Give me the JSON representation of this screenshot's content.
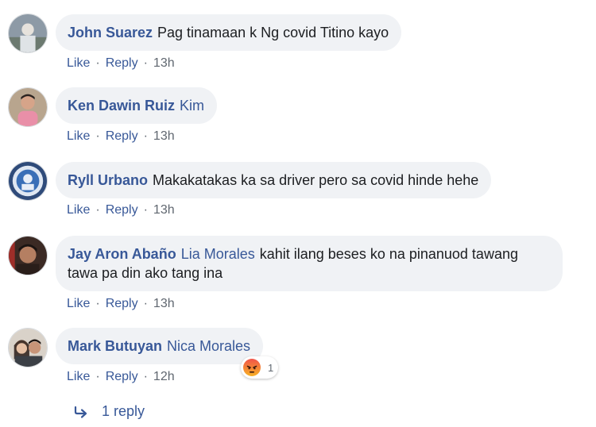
{
  "comments": [
    {
      "author": "John Suarez",
      "mention": "",
      "text": "Pag tinamaan k Ng covid Titino kayo",
      "like": "Like",
      "reply": "Reply",
      "time": "13h"
    },
    {
      "author": "Ken Dawin Ruiz",
      "mention": "",
      "text": "Kim",
      "like": "Like",
      "reply": "Reply",
      "time": "13h"
    },
    {
      "author": "Ryll Urbano",
      "mention": "",
      "text": "Makakatakas ka sa driver pero sa covid hinde hehe",
      "like": "Like",
      "reply": "Reply",
      "time": "13h"
    },
    {
      "author": "Jay Aron Abaño",
      "mention": "Lia Morales",
      "text": "kahit ilang beses ko na pinanuod tawang tawa pa din ako tang ina",
      "like": "Like",
      "reply": "Reply",
      "time": "13h"
    },
    {
      "author": "Mark Butuyan",
      "mention": "Nica Morales",
      "text": "",
      "like": "Like",
      "reply": "Reply",
      "time": "12h",
      "reaction_count": "1"
    }
  ],
  "replies_label": "1 reply",
  "colors": {
    "link": "#385898",
    "bubble": "#f0f2f5",
    "meta": "#606770"
  }
}
